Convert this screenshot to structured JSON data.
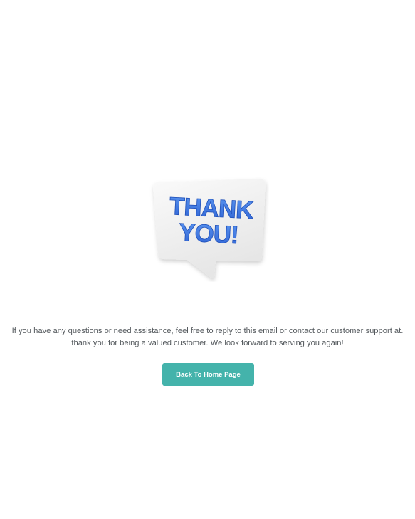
{
  "illustration": {
    "line1": "THANK",
    "line2": "YOU!",
    "text_color": "#3a78e0",
    "bubble_color": "#f2f2f2"
  },
  "message": {
    "line1": "If you have any questions or need assistance, feel free to reply to this email or contact our customer support at.",
    "line2": "thank you for being a valued customer. We look forward to serving you again!"
  },
  "actions": {
    "back_home_label": "Back To Home Page",
    "accent_color": "#44b3ab"
  }
}
